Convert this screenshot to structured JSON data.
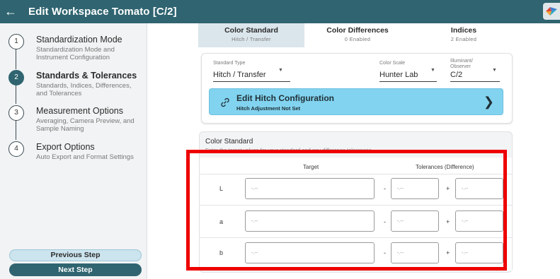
{
  "window": {
    "title": "Edit Workspace Tomato [C/2]",
    "back_icon": "arrow-left-icon",
    "accent_color": "#2f6470"
  },
  "sidebar": {
    "steps": [
      {
        "number": "1",
        "title": "Standardization Mode",
        "description": "Standardization Mode and Instrument Configuration",
        "active": false
      },
      {
        "number": "2",
        "title": "Standards & Tolerances",
        "description": "Standards, Indices, Differences, and Tolerances",
        "active": true
      },
      {
        "number": "3",
        "title": "Measurement Options",
        "description": "Averaging, Camera Preview, and Sample Naming",
        "active": false
      },
      {
        "number": "4",
        "title": "Export Options",
        "description": "Auto Export and Format Settings",
        "active": false
      }
    ],
    "previous_label": "Previous Step",
    "next_label": "Next Step"
  },
  "tabs": [
    {
      "label": "Color Standard",
      "sub": "Hitch / Transfer",
      "active": true
    },
    {
      "label": "Color Differences",
      "sub": "0 Enabled",
      "active": false
    },
    {
      "label": "Indices",
      "sub": "2 Enabled",
      "active": false
    }
  ],
  "settings": {
    "standard_type_label": "Standard Type",
    "standard_type_value": "Hitch / Transfer",
    "color_scale_label": "Color Scale",
    "color_scale_value": "Hunter Lab",
    "illuminant_label": "Illuminant/ Observer",
    "illuminant_value": "C/2"
  },
  "hitch": {
    "title": "Edit Hitch Configuration",
    "subtitle": "Hitch Adjustment Not Set",
    "color": "#82d3ef"
  },
  "color_standard": {
    "title": "Color Standard",
    "subtitle": "Enter the target values for your standard and any difference tolerances.",
    "target_header": "Target",
    "tolerance_header": "Tolerances (Difference)",
    "minus": "-",
    "plus": "+",
    "rows": [
      {
        "label": "L",
        "target": "-.--",
        "minus": "-.--",
        "plus": "-.--"
      },
      {
        "label": "a",
        "target": "-.--",
        "minus": "-.--",
        "plus": "-.--"
      },
      {
        "label": "b",
        "target": "-.--",
        "minus": "-.--",
        "plus": "-.--"
      }
    ]
  },
  "highlight_color": "#ee0000"
}
